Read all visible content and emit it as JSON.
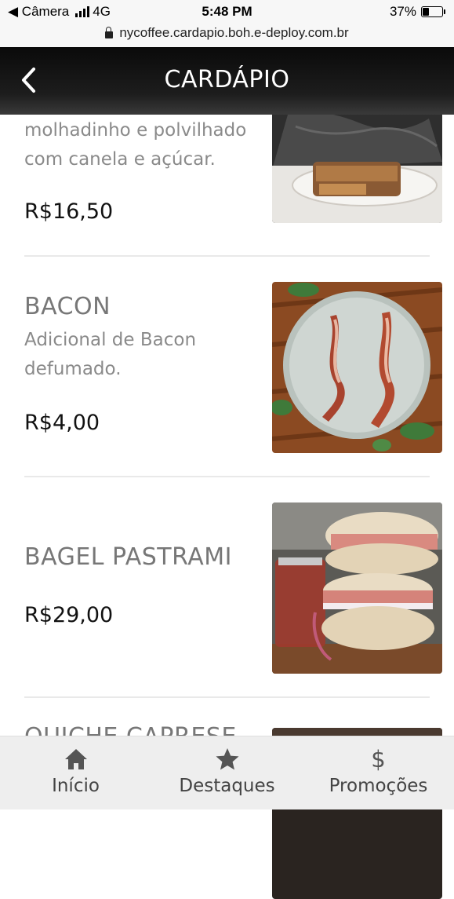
{
  "status_bar": {
    "back_app": "◀ Câmera",
    "network": "4G",
    "time": "5:48 PM",
    "battery_percent": "37%",
    "battery_level": 0.37
  },
  "browser": {
    "url": "nycoffee.cardapio.boh.e-deploy.com.br"
  },
  "header": {
    "title": "CARDÁPIO"
  },
  "menu": {
    "items": [
      {
        "name": "",
        "description": "molhadinho e polvilhado com canela e açúcar.",
        "price": "R$16,50",
        "image": "french-toast-photo"
      },
      {
        "name": "BACON",
        "description": "Adicional de Bacon defumado.",
        "price": "R$4,00",
        "image": "bacon-plate-photo"
      },
      {
        "name": "BAGEL PASTRAMI",
        "description": "",
        "price": "R$29,00",
        "image": "bagel-pastrami-photo"
      },
      {
        "name": "QUICHE CAPRESE",
        "description": "",
        "price": "",
        "image": "quiche-photo"
      }
    ]
  },
  "bottom_nav": {
    "items": [
      {
        "label": "Início",
        "icon": "home-icon"
      },
      {
        "label": "Destaques",
        "icon": "star-icon"
      },
      {
        "label": "Promoções",
        "icon": "dollar-icon"
      }
    ]
  },
  "colors": {
    "header_bg": "#0a0a0a",
    "item_name": "#777777",
    "item_desc": "#8a8a8a",
    "price": "#111111",
    "nav_bg": "#eeeeee"
  }
}
